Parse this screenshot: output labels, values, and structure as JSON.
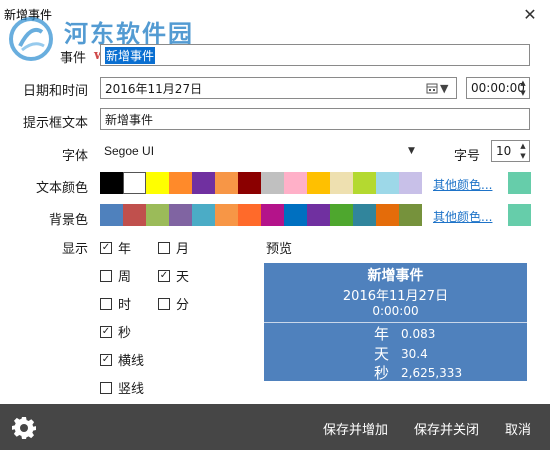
{
  "window": {
    "title": "新增事件",
    "close_glyph": "✕"
  },
  "watermark": {
    "text": "河东软件园",
    "url": "www.pc0359.cn",
    "logo_icon": "river-east-logo"
  },
  "form": {
    "event_label": "事件",
    "event_value": "新增事件",
    "datetime_label": "日期和时间",
    "date_value": "2016年11月27日",
    "time_value": "00:00:00",
    "tooltip_label": "提示框文本",
    "tooltip_value": "新增事件",
    "font_label": "字体",
    "font_value": "Segoe UI",
    "size_label": "字号",
    "size_value": "10",
    "text_color_label": "文本颜色",
    "bg_color_label": "背景色",
    "more_colors": "其他颜色...",
    "display_label": "显示",
    "preview_label": "预览"
  },
  "colors": {
    "text_palette": [
      "#000000",
      "#ffffff",
      "#ffff00",
      "#ff8a2a",
      "#7030a0",
      "#f79646",
      "#8b0000",
      "#c0c0c0",
      "#ffb0c8",
      "#ffc000",
      "#eee0b0",
      "#b4d930",
      "#9dd8e8",
      "#c8c0e8"
    ],
    "text_selected_index": 1,
    "text_current": "#66cdaa",
    "bg_palette": [
      "#4f81bd",
      "#c0504d",
      "#9bbb59",
      "#8064a2",
      "#4bacc6",
      "#f79646",
      "#ff6a2a",
      "#b4138a",
      "#0070c0",
      "#7030a0",
      "#4ea72e",
      "#31859c",
      "#e46c0a",
      "#76923c"
    ],
    "bg_current": "#66cdaa",
    "preview_bg": "#4f81bd",
    "footer_bg": "#464646",
    "link": "#1e73c8"
  },
  "display_options": [
    {
      "label": "年",
      "checked": true
    },
    {
      "label": "月",
      "checked": false
    },
    {
      "label": "周",
      "checked": false
    },
    {
      "label": "天",
      "checked": true
    },
    {
      "label": "时",
      "checked": false
    },
    {
      "label": "分",
      "checked": false
    },
    {
      "label": "秒",
      "checked": true
    },
    {
      "label": "横线",
      "checked": true
    },
    {
      "label": "竖线",
      "checked": false
    }
  ],
  "preview": {
    "title": "新增事件",
    "date": "2016年11月27日",
    "time": "0:00:00",
    "rows": [
      {
        "unit": "年",
        "value": "0.083"
      },
      {
        "unit": "天",
        "value": "30.4"
      },
      {
        "unit": "秒",
        "value": "2,625,333"
      }
    ]
  },
  "footer": {
    "settings_icon": "gear-icon",
    "save_add": "保存并增加",
    "save_close": "保存并关闭",
    "cancel": "取消"
  }
}
